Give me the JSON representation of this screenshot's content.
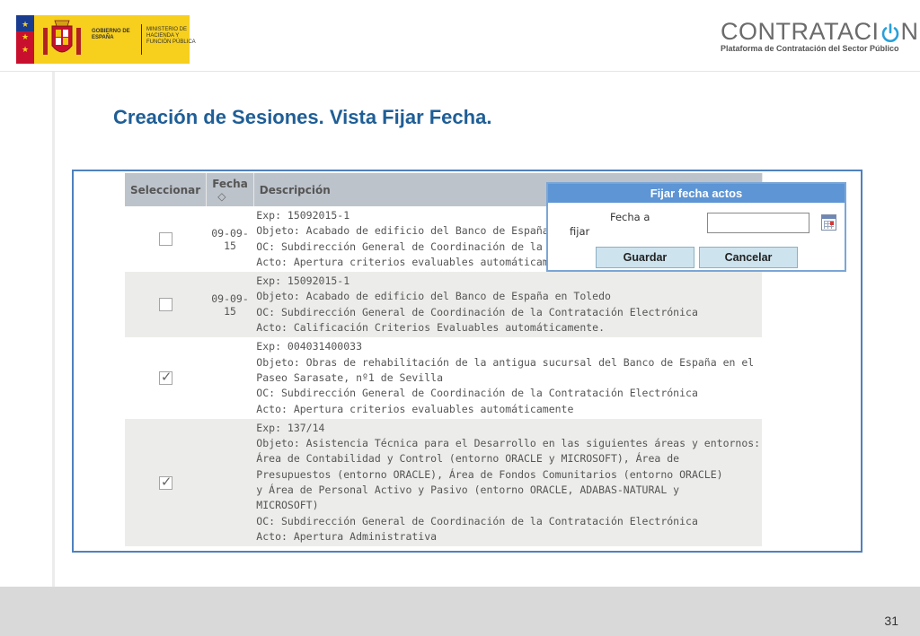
{
  "header": {
    "gov_logo": {
      "line1": "GOBIERNO DE ESPAÑA",
      "line2": "MINISTERIO DE HACIENDA Y FUNCIÓN PÚBLICA"
    },
    "brand": {
      "name_before": "CONTRATACI",
      "name_after": "N",
      "subtitle": "Plataforma de Contratación del Sector Público"
    }
  },
  "title": "Creación de Sesiones. Vista Fijar Fecha.",
  "table": {
    "columns": [
      "Seleccionar",
      "Fecha",
      "Descripción"
    ],
    "rows": [
      {
        "checked": false,
        "fecha": "09-09-15",
        "lines": [
          "Exp: 15092015-1",
          "Objeto: Acabado de edificio del Banco de España",
          "OC: Subdirección General de Coordinación de la",
          "Acto: Apertura criterios evaluables automáticame"
        ]
      },
      {
        "checked": false,
        "fecha": "09-09-15",
        "lines": [
          "Exp: 15092015-1",
          "Objeto: Acabado de edificio del Banco de España en Toledo",
          "OC: Subdirección General de Coordinación de la Contratación Electrónica",
          "Acto: Calificación Criterios Evaluables automáticamente."
        ]
      },
      {
        "checked": true,
        "fecha": "",
        "lines": [
          "Exp: 004031400033",
          "Objeto: Obras de rehabilitación de la antigua sucursal del Banco de España en el",
          "Paseo Sarasate, nº1 de Sevilla",
          "OC: Subdirección General de Coordinación de la Contratación Electrónica",
          "Acto: Apertura criterios evaluables automáticamente"
        ]
      },
      {
        "checked": true,
        "fecha": "",
        "lines": [
          "Exp: 137/14",
          "Objeto: Asistencia Técnica para el Desarrollo en las siguientes áreas y entornos:",
          "Área de Contabilidad y Control (entorno ORACLE y MICROSOFT), Área de",
          "Presupuestos (entorno ORACLE), Área de Fondos Comunitarios (entorno ORACLE)",
          "y Área de Personal Activo y Pasivo (entorno ORACLE, ADABAS-NATURAL y",
          "MICROSOFT)",
          "OC: Subdirección General de Coordinación de la Contratación Electrónica",
          "Acto: Apertura Administrativa"
        ]
      }
    ]
  },
  "popup": {
    "title": "Fijar fecha actos",
    "label_line1": "Fecha a",
    "label_line2": "fijar",
    "input_value": "",
    "save_label": "Guardar",
    "cancel_label": "Cancelar"
  },
  "footer": {
    "page_number": "31"
  },
  "icons": {
    "sort": "sort-updown-icon",
    "calendar": "calendar-icon",
    "power": "power-icon"
  },
  "colors": {
    "title": "#1f5e96",
    "frame_border": "#4f81bd",
    "popup_header": "#5d95d5",
    "button_bg": "#cde3ee",
    "table_header_bg": "#bdc3cb"
  }
}
